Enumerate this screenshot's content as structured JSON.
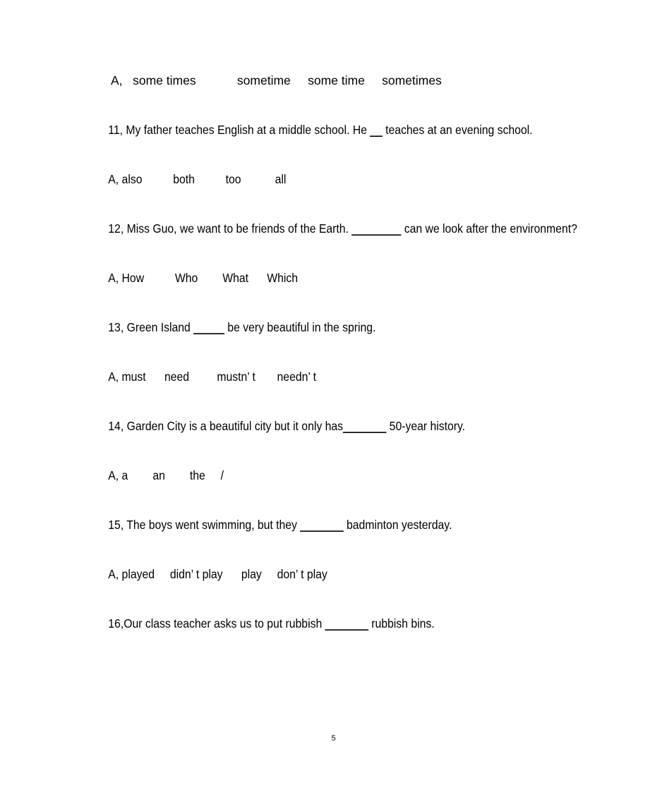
{
  "document": {
    "page_number": "5",
    "blocks": [
      {
        "id": "q10-options",
        "kind": "options",
        "wide": true,
        "text": "A,   some times            sometime     some time     sometimes"
      },
      {
        "id": "q11-stem",
        "kind": "question",
        "number": "11,",
        "text_before": "11, My father teaches English at a middle school. He ",
        "blank": "__",
        "text_after": " teaches at an evening school."
      },
      {
        "id": "q11-options",
        "kind": "options",
        "text": "A, also          both          too           all"
      },
      {
        "id": "q12-stem",
        "kind": "question",
        "number": "12,",
        "text_before": "12, Miss Guo, we want to be friends of   the Earth. ",
        "blank": "________",
        "text_after": " can we look after the environment?"
      },
      {
        "id": "q12-options",
        "kind": "options",
        "text": "A, How          Who        What      Which"
      },
      {
        "id": "q13-stem",
        "kind": "question",
        "number": "13,",
        "text_before": "13, Green Island ",
        "blank": "_____",
        "text_after": " be very beautiful in the spring."
      },
      {
        "id": "q13-options",
        "kind": "options",
        "text": "A, must      need         mustn’ t       needn’ t"
      },
      {
        "id": "q14-stem",
        "kind": "question",
        "number": "14,",
        "text_before": "14, Garden City is a beautiful city but it only has",
        "blank": "_______",
        "text_after": " 50-year history."
      },
      {
        "id": "q14-options",
        "kind": "options",
        "text": "A, a        an        the     /"
      },
      {
        "id": "q15-stem",
        "kind": "question",
        "number": "15,",
        "text_before": "15, The boys went swimming, but they ",
        "blank": "_______",
        "text_after": " badminton yesterday."
      },
      {
        "id": "q15-options",
        "kind": "options",
        "text": "A, played     didn’ t play      play     don’ t play"
      },
      {
        "id": "q16-stem",
        "kind": "question",
        "number": "16,",
        "text_before": "16,Our class teacher asks us to put rubbish ",
        "blank": "_______",
        "text_after": " rubbish bins."
      }
    ]
  }
}
